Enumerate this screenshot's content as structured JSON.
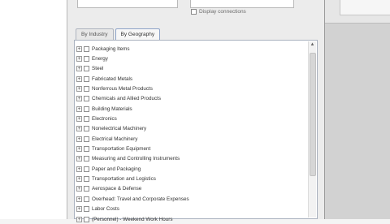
{
  "display_checkbox_label": "Display connections",
  "tabs": [
    {
      "label": "By Industry",
      "active": false
    },
    {
      "label": "By Geography",
      "active": true
    }
  ],
  "tree_items": [
    "Packaging Items",
    "Energy",
    "Steel",
    "Fabricated Metals",
    "Nonferrous Metal Products",
    "Chemicals and Allied Products",
    "Building Materials",
    "Electronics",
    "Nonelectrical Machinery",
    "Electrical Machinery",
    "Transportation Equipment",
    "Measuring and Controlling Instruments",
    "Paper and Packaging",
    "Transportation and Logistics",
    "Aerospace & Defense",
    "Overhead: Travel and Corporate Expenses",
    "Labor Costs",
    "(Personnel) - Weekend Work Hours"
  ],
  "colors": {
    "active_tab_border": "#8ea3c8",
    "panel_border": "#aab2bf"
  }
}
